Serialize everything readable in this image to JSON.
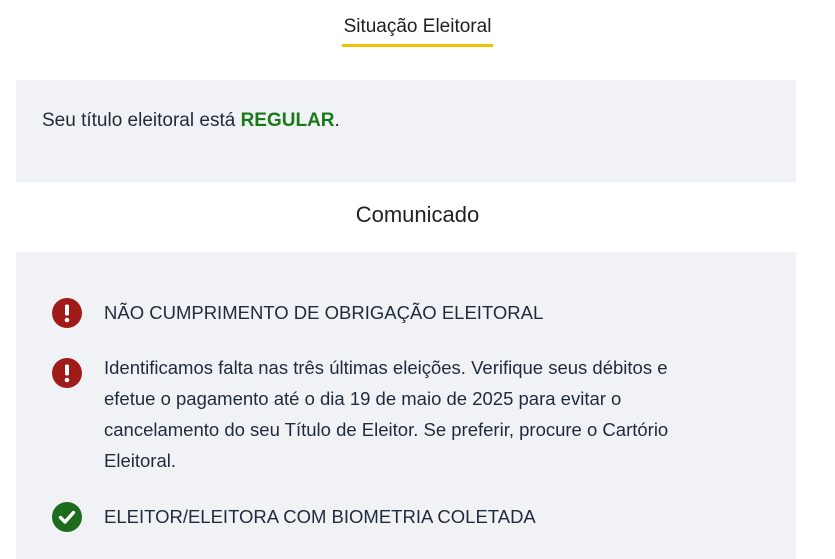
{
  "header": {
    "tab_label": "Situação Eleitoral"
  },
  "status": {
    "prefix": "Seu título eleitoral está ",
    "value": "REGULAR",
    "suffix": ".",
    "value_color": "#1a7a1a"
  },
  "communique": {
    "title": "Comunicado",
    "items": [
      {
        "icon": "exclamation-icon",
        "icon_color": "#a11a1a",
        "text": "NÃO CUMPRIMENTO DE OBRIGAÇÃO ELEITORAL"
      },
      {
        "icon": "exclamation-icon",
        "icon_color": "#a11a1a",
        "text": "Identificamos falta nas três últimas eleições. Verifique seus débitos e efetue o pagamento até o dia 19 de maio de 2025 para evitar o cancelamento do seu Título de Eleitor. Se preferir, procure o Cartório Eleitoral."
      },
      {
        "icon": "check-icon",
        "icon_color": "#1d6b1d",
        "text": "ELEITOR/ELEITORA COM BIOMETRIA COLETADA"
      }
    ]
  },
  "colors": {
    "accent_underline": "#f2c200",
    "box_background": "#f0f2f5"
  }
}
